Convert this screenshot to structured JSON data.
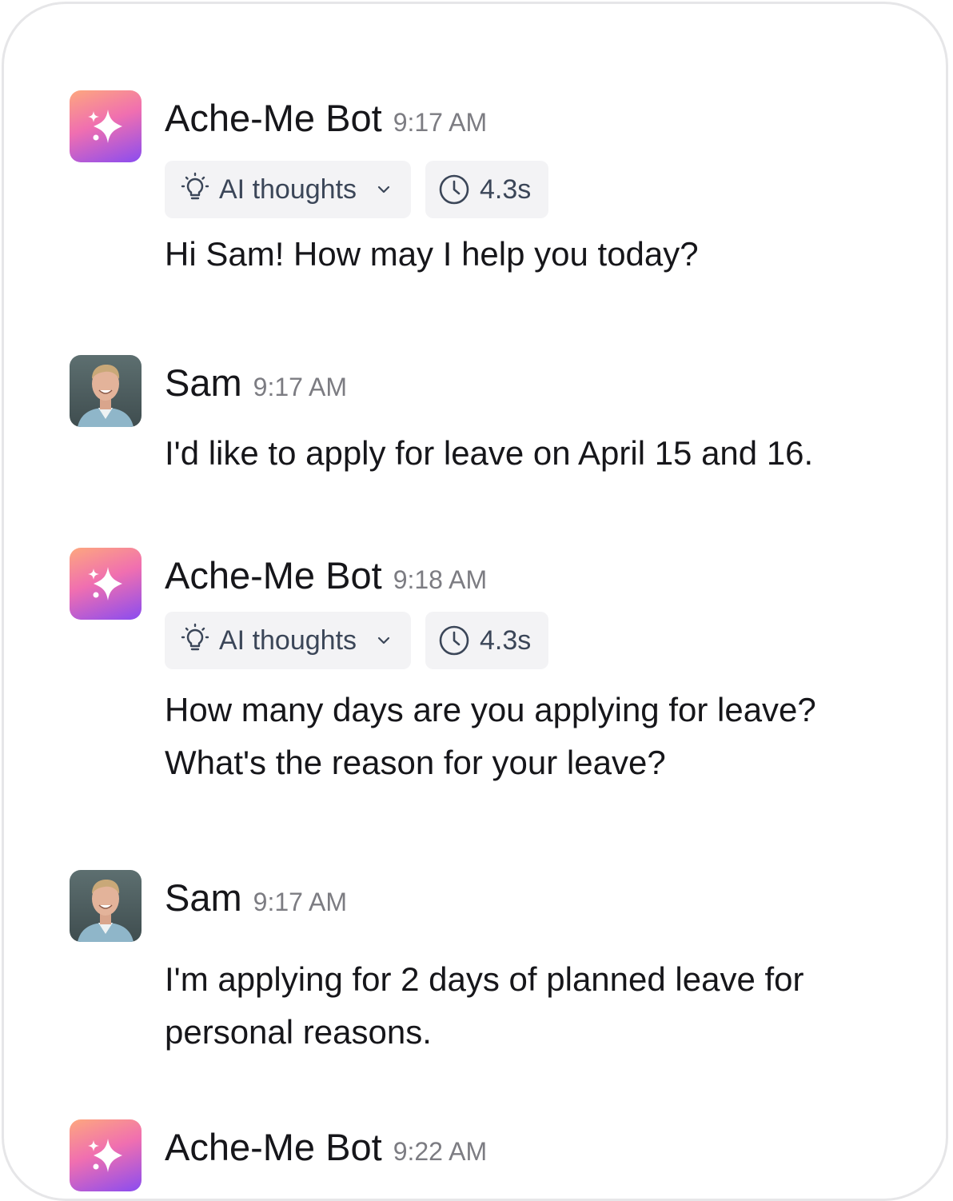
{
  "messages": [
    {
      "sender": "Ache-Me Bot",
      "time": "9:17 AM",
      "thoughts_label": "AI thoughts",
      "duration": "4.3s",
      "lines": [
        "Hi Sam! How may I help you today?"
      ]
    },
    {
      "sender": "Sam",
      "time": "9:17 AM",
      "lines": [
        "I'd like to apply for leave on April 15 and 16."
      ]
    },
    {
      "sender": "Ache-Me Bot",
      "time": "9:18 AM",
      "thoughts_label": "AI thoughts",
      "duration": "4.3s",
      "lines": [
        "How many days are you applying for leave?",
        "What's the reason for your leave?"
      ]
    },
    {
      "sender": "Sam",
      "time": "9:17 AM",
      "lines": [
        "I'm applying for 2 days of planned leave for",
        "personal reasons."
      ]
    },
    {
      "sender": "Ache-Me Bot",
      "time": "9:22 AM"
    }
  ],
  "icons": {
    "bot_avatar": "sparkle-icon",
    "user_avatar": "user-photo",
    "thoughts": "lightbulb-icon",
    "expand": "chevron-down-icon",
    "duration": "clock-icon"
  },
  "colors": {
    "bot_gradient": [
      "#fda77e",
      "#f06fb0",
      "#8a4cf0"
    ],
    "chip_bg": "#f3f3f5",
    "chip_text": "#3b4658",
    "timestamp": "#7c7c82"
  }
}
